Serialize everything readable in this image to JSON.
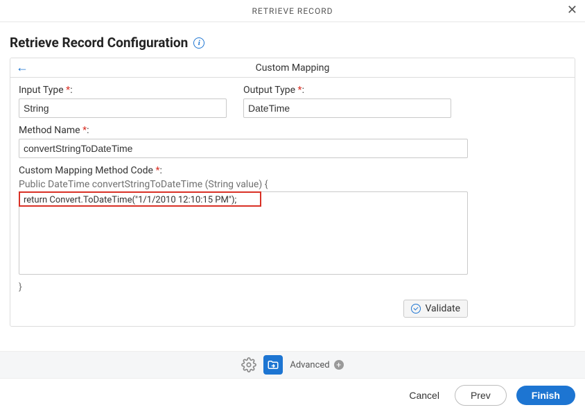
{
  "titlebar": {
    "title": "RETRIEVE RECORD"
  },
  "page": {
    "title": "Retrieve Record Configuration"
  },
  "panel": {
    "header": "Custom Mapping"
  },
  "form": {
    "inputType": {
      "label": "Input Type",
      "value": "String"
    },
    "outputType": {
      "label": "Output Type",
      "value": "DateTime"
    },
    "methodName": {
      "label": "Method Name",
      "value": "convertStringToDateTime"
    },
    "codeLabel": "Custom Mapping Method Code",
    "signature": "Public DateTime convertStringToDateTime (String value) {",
    "codeBody": "return Convert.ToDateTime(\"1/1/2010 12:10:15 PM\");",
    "closeBrace": "}"
  },
  "buttons": {
    "validate": "Validate",
    "advanced": "Advanced",
    "cancel": "Cancel",
    "prev": "Prev",
    "finish": "Finish"
  },
  "required_marker": "*",
  "colon": ":"
}
